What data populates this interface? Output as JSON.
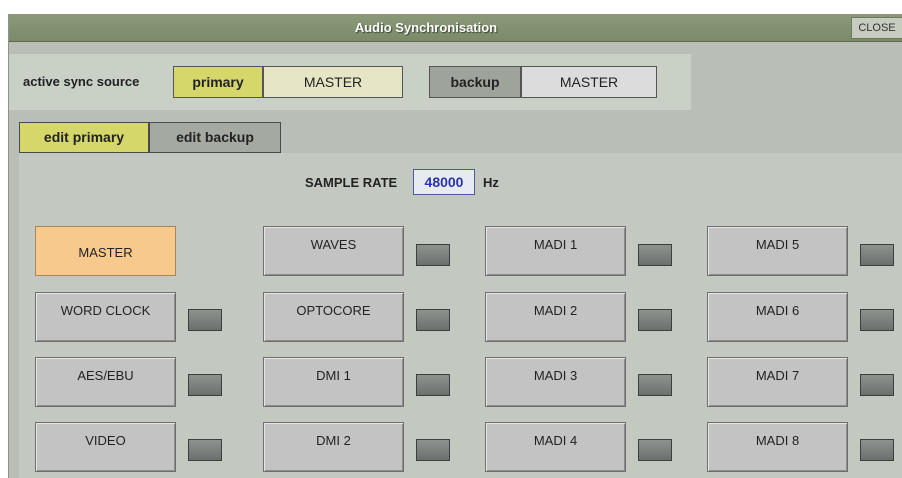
{
  "window": {
    "title": "Audio Synchronisation",
    "close_label": "CLOSE"
  },
  "sync": {
    "label": "active sync source",
    "primary_tag": "primary",
    "primary_value": "MASTER",
    "backup_tag": "backup",
    "backup_value": "MASTER"
  },
  "tabs": {
    "edit_primary": "edit primary",
    "edit_backup": "edit backup",
    "active": "edit primary"
  },
  "sample_rate": {
    "label": "SAMPLE RATE",
    "value": "48000",
    "unit": "Hz"
  },
  "sources": [
    {
      "label": "MASTER",
      "active": true,
      "led": false
    },
    {
      "label": "WAVES",
      "active": false,
      "led": true
    },
    {
      "label": "MADI 1",
      "active": false,
      "led": true
    },
    {
      "label": "MADI 5",
      "active": false,
      "led": true
    },
    {
      "label": "WORD CLOCK",
      "active": false,
      "led": true
    },
    {
      "label": "OPTOCORE",
      "active": false,
      "led": true
    },
    {
      "label": "MADI 2",
      "active": false,
      "led": true
    },
    {
      "label": "MADI 6",
      "active": false,
      "led": true
    },
    {
      "label": "AES/EBU",
      "active": false,
      "led": true
    },
    {
      "label": "DMI 1",
      "active": false,
      "led": true
    },
    {
      "label": "MADI 3",
      "active": false,
      "led": true
    },
    {
      "label": "MADI 7",
      "active": false,
      "led": true
    },
    {
      "label": "VIDEO",
      "active": false,
      "led": true
    },
    {
      "label": "DMI 2",
      "active": false,
      "led": true
    },
    {
      "label": "MADI 4",
      "active": false,
      "led": true
    },
    {
      "label": "MADI 8",
      "active": false,
      "led": true
    }
  ],
  "colors": {
    "accent_yellow": "#d6d76a",
    "active_source": "#f8c98c",
    "sample_rate_text": "#2a34a8",
    "titlebar": "#7b8b6a"
  }
}
